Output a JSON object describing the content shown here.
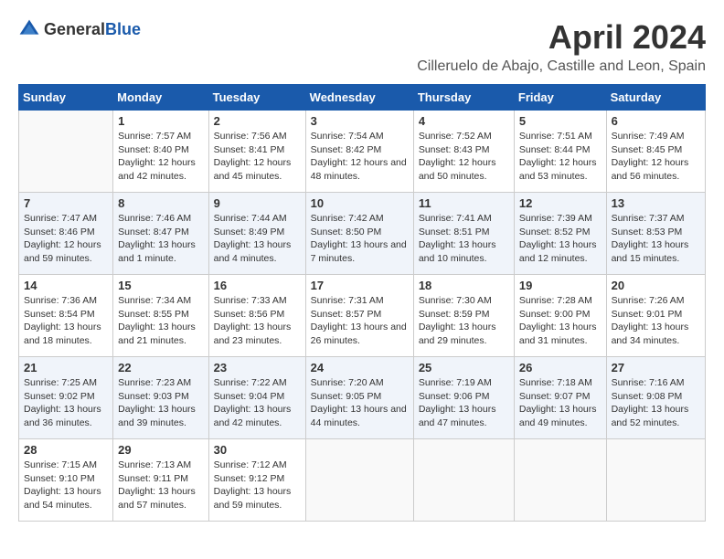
{
  "header": {
    "logo_general": "General",
    "logo_blue": "Blue",
    "title": "April 2024",
    "subtitle": "Cilleruelo de Abajo, Castille and Leon, Spain"
  },
  "calendar": {
    "columns": [
      "Sunday",
      "Monday",
      "Tuesday",
      "Wednesday",
      "Thursday",
      "Friday",
      "Saturday"
    ],
    "weeks": [
      [
        {
          "day": "",
          "sunrise": "",
          "sunset": "",
          "daylight": ""
        },
        {
          "day": "1",
          "sunrise": "Sunrise: 7:57 AM",
          "sunset": "Sunset: 8:40 PM",
          "daylight": "Daylight: 12 hours and 42 minutes."
        },
        {
          "day": "2",
          "sunrise": "Sunrise: 7:56 AM",
          "sunset": "Sunset: 8:41 PM",
          "daylight": "Daylight: 12 hours and 45 minutes."
        },
        {
          "day": "3",
          "sunrise": "Sunrise: 7:54 AM",
          "sunset": "Sunset: 8:42 PM",
          "daylight": "Daylight: 12 hours and 48 minutes."
        },
        {
          "day": "4",
          "sunrise": "Sunrise: 7:52 AM",
          "sunset": "Sunset: 8:43 PM",
          "daylight": "Daylight: 12 hours and 50 minutes."
        },
        {
          "day": "5",
          "sunrise": "Sunrise: 7:51 AM",
          "sunset": "Sunset: 8:44 PM",
          "daylight": "Daylight: 12 hours and 53 minutes."
        },
        {
          "day": "6",
          "sunrise": "Sunrise: 7:49 AM",
          "sunset": "Sunset: 8:45 PM",
          "daylight": "Daylight: 12 hours and 56 minutes."
        }
      ],
      [
        {
          "day": "7",
          "sunrise": "Sunrise: 7:47 AM",
          "sunset": "Sunset: 8:46 PM",
          "daylight": "Daylight: 12 hours and 59 minutes."
        },
        {
          "day": "8",
          "sunrise": "Sunrise: 7:46 AM",
          "sunset": "Sunset: 8:47 PM",
          "daylight": "Daylight: 13 hours and 1 minute."
        },
        {
          "day": "9",
          "sunrise": "Sunrise: 7:44 AM",
          "sunset": "Sunset: 8:49 PM",
          "daylight": "Daylight: 13 hours and 4 minutes."
        },
        {
          "day": "10",
          "sunrise": "Sunrise: 7:42 AM",
          "sunset": "Sunset: 8:50 PM",
          "daylight": "Daylight: 13 hours and 7 minutes."
        },
        {
          "day": "11",
          "sunrise": "Sunrise: 7:41 AM",
          "sunset": "Sunset: 8:51 PM",
          "daylight": "Daylight: 13 hours and 10 minutes."
        },
        {
          "day": "12",
          "sunrise": "Sunrise: 7:39 AM",
          "sunset": "Sunset: 8:52 PM",
          "daylight": "Daylight: 13 hours and 12 minutes."
        },
        {
          "day": "13",
          "sunrise": "Sunrise: 7:37 AM",
          "sunset": "Sunset: 8:53 PM",
          "daylight": "Daylight: 13 hours and 15 minutes."
        }
      ],
      [
        {
          "day": "14",
          "sunrise": "Sunrise: 7:36 AM",
          "sunset": "Sunset: 8:54 PM",
          "daylight": "Daylight: 13 hours and 18 minutes."
        },
        {
          "day": "15",
          "sunrise": "Sunrise: 7:34 AM",
          "sunset": "Sunset: 8:55 PM",
          "daylight": "Daylight: 13 hours and 21 minutes."
        },
        {
          "day": "16",
          "sunrise": "Sunrise: 7:33 AM",
          "sunset": "Sunset: 8:56 PM",
          "daylight": "Daylight: 13 hours and 23 minutes."
        },
        {
          "day": "17",
          "sunrise": "Sunrise: 7:31 AM",
          "sunset": "Sunset: 8:57 PM",
          "daylight": "Daylight: 13 hours and 26 minutes."
        },
        {
          "day": "18",
          "sunrise": "Sunrise: 7:30 AM",
          "sunset": "Sunset: 8:59 PM",
          "daylight": "Daylight: 13 hours and 29 minutes."
        },
        {
          "day": "19",
          "sunrise": "Sunrise: 7:28 AM",
          "sunset": "Sunset: 9:00 PM",
          "daylight": "Daylight: 13 hours and 31 minutes."
        },
        {
          "day": "20",
          "sunrise": "Sunrise: 7:26 AM",
          "sunset": "Sunset: 9:01 PM",
          "daylight": "Daylight: 13 hours and 34 minutes."
        }
      ],
      [
        {
          "day": "21",
          "sunrise": "Sunrise: 7:25 AM",
          "sunset": "Sunset: 9:02 PM",
          "daylight": "Daylight: 13 hours and 36 minutes."
        },
        {
          "day": "22",
          "sunrise": "Sunrise: 7:23 AM",
          "sunset": "Sunset: 9:03 PM",
          "daylight": "Daylight: 13 hours and 39 minutes."
        },
        {
          "day": "23",
          "sunrise": "Sunrise: 7:22 AM",
          "sunset": "Sunset: 9:04 PM",
          "daylight": "Daylight: 13 hours and 42 minutes."
        },
        {
          "day": "24",
          "sunrise": "Sunrise: 7:20 AM",
          "sunset": "Sunset: 9:05 PM",
          "daylight": "Daylight: 13 hours and 44 minutes."
        },
        {
          "day": "25",
          "sunrise": "Sunrise: 7:19 AM",
          "sunset": "Sunset: 9:06 PM",
          "daylight": "Daylight: 13 hours and 47 minutes."
        },
        {
          "day": "26",
          "sunrise": "Sunrise: 7:18 AM",
          "sunset": "Sunset: 9:07 PM",
          "daylight": "Daylight: 13 hours and 49 minutes."
        },
        {
          "day": "27",
          "sunrise": "Sunrise: 7:16 AM",
          "sunset": "Sunset: 9:08 PM",
          "daylight": "Daylight: 13 hours and 52 minutes."
        }
      ],
      [
        {
          "day": "28",
          "sunrise": "Sunrise: 7:15 AM",
          "sunset": "Sunset: 9:10 PM",
          "daylight": "Daylight: 13 hours and 54 minutes."
        },
        {
          "day": "29",
          "sunrise": "Sunrise: 7:13 AM",
          "sunset": "Sunset: 9:11 PM",
          "daylight": "Daylight: 13 hours and 57 minutes."
        },
        {
          "day": "30",
          "sunrise": "Sunrise: 7:12 AM",
          "sunset": "Sunset: 9:12 PM",
          "daylight": "Daylight: 13 hours and 59 minutes."
        },
        {
          "day": "",
          "sunrise": "",
          "sunset": "",
          "daylight": ""
        },
        {
          "day": "",
          "sunrise": "",
          "sunset": "",
          "daylight": ""
        },
        {
          "day": "",
          "sunrise": "",
          "sunset": "",
          "daylight": ""
        },
        {
          "day": "",
          "sunrise": "",
          "sunset": "",
          "daylight": ""
        }
      ]
    ]
  }
}
